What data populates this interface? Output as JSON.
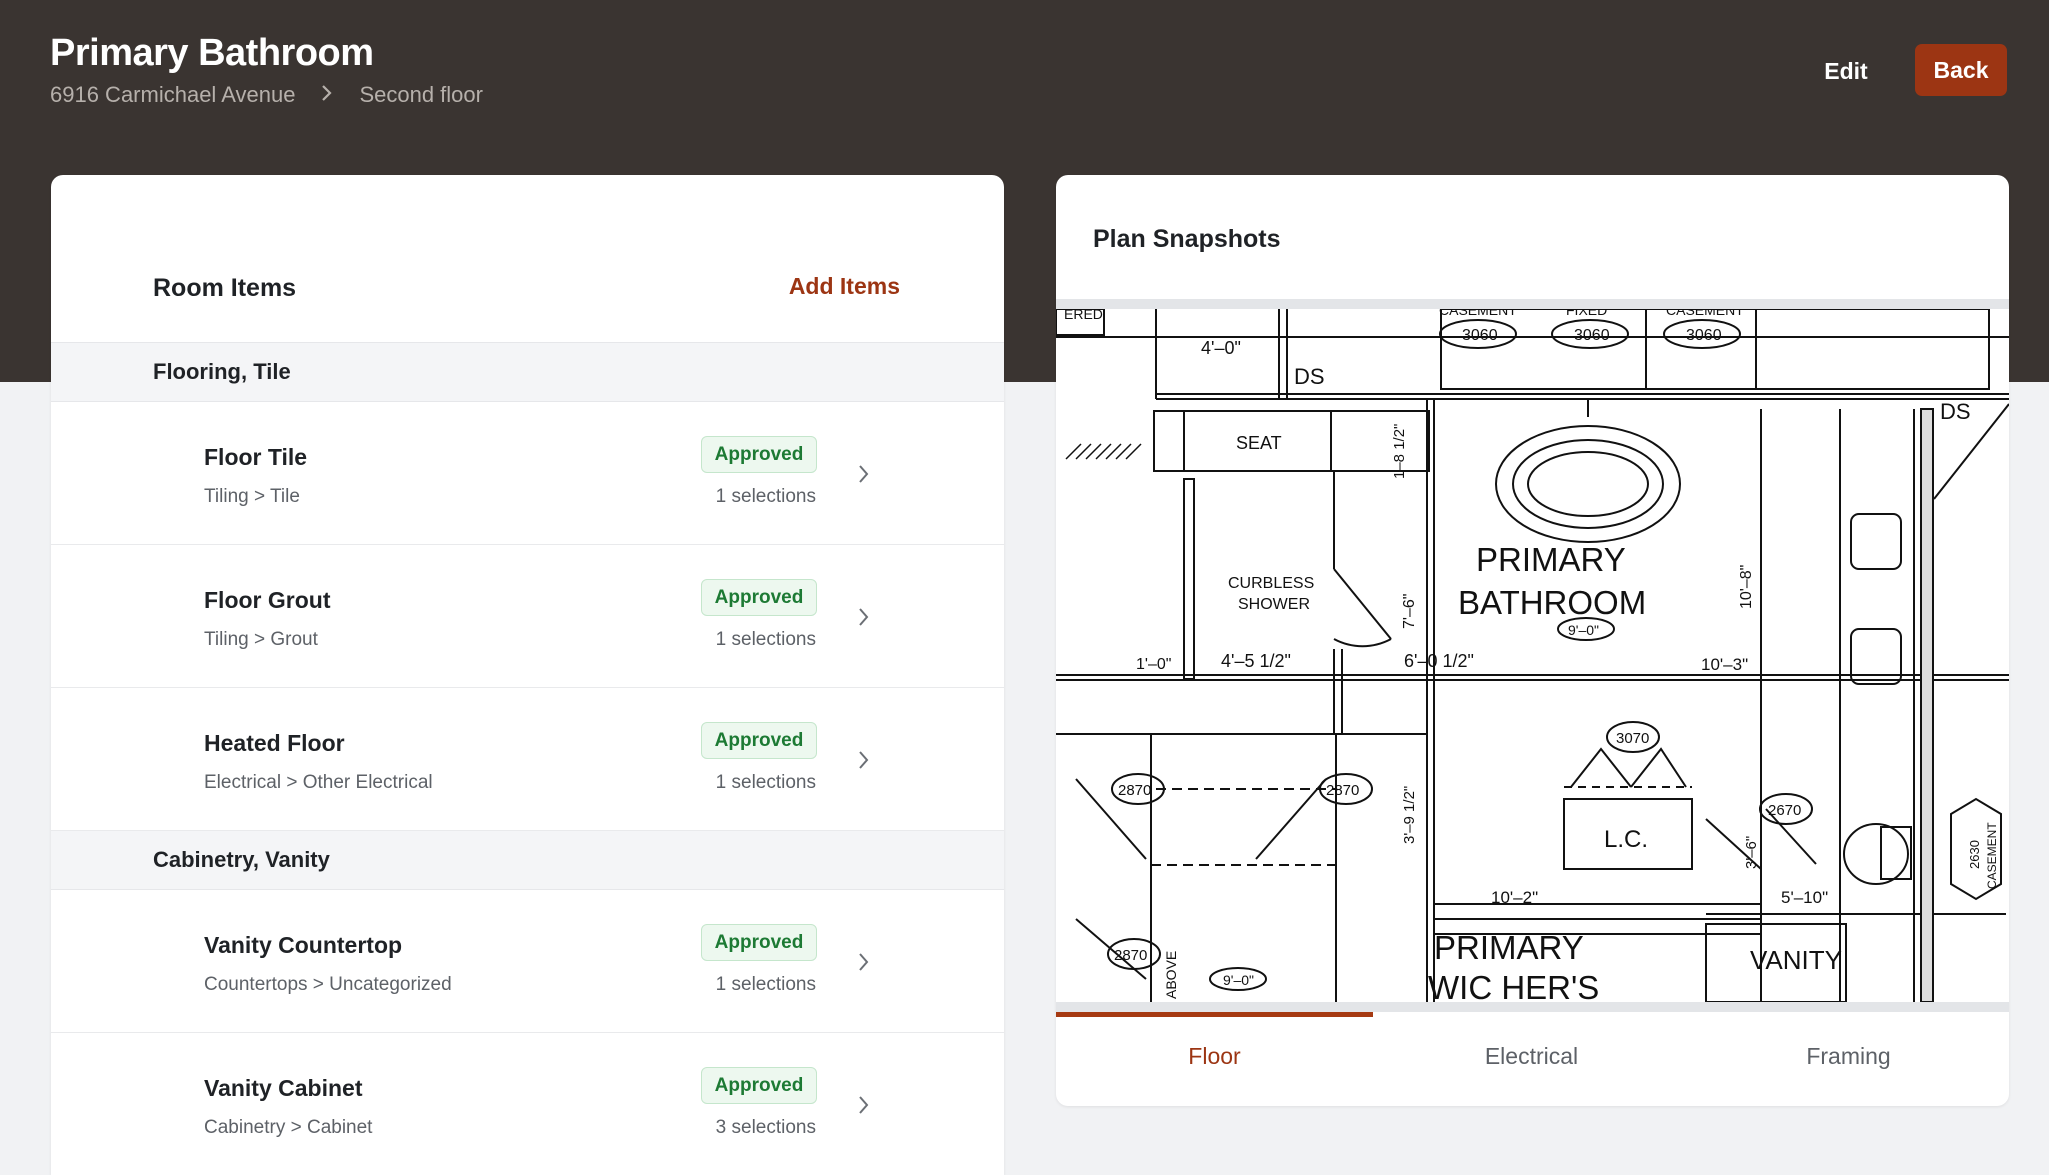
{
  "header": {
    "title": "Primary Bathroom",
    "breadcrumb": [
      "6916 Carmichael Avenue",
      "Second floor"
    ],
    "edit_label": "Edit",
    "back_label": "Back"
  },
  "room_items": {
    "title": "Room Items",
    "add_label": "Add Items",
    "groups": [
      {
        "name": "Flooring, Tile",
        "items": [
          {
            "name": "Floor Tile",
            "category": "Tiling > Tile",
            "status": "Approved",
            "selections": "1 selections"
          },
          {
            "name": "Floor Grout",
            "category": "Tiling > Grout",
            "status": "Approved",
            "selections": "1 selections"
          },
          {
            "name": "Heated Floor",
            "category": "Electrical > Other Electrical",
            "status": "Approved",
            "selections": "1 selections"
          }
        ]
      },
      {
        "name": "Cabinetry, Vanity",
        "items": [
          {
            "name": "Vanity Countertop",
            "category": "Countertops > Uncategorized",
            "status": "Approved",
            "selections": "1 selections"
          },
          {
            "name": "Vanity Cabinet",
            "category": "Cabinetry > Cabinet",
            "status": "Approved",
            "selections": "3 selections"
          }
        ]
      }
    ]
  },
  "plans": {
    "title": "Plan Snapshots",
    "tabs": [
      {
        "label": "Floor",
        "active": true
      },
      {
        "label": "Electrical",
        "active": false
      },
      {
        "label": "Framing",
        "active": false
      }
    ],
    "drawing_labels": {
      "casement_a": "CASEMENT",
      "window_a": "3060",
      "fixed": "FIXED",
      "window_b": "3060",
      "casement_b": "CASEMENT",
      "window_c": "3060",
      "dim_4_0": "4'–0\"",
      "ds_a": "DS",
      "ds_b": "DS",
      "seat": "SEAT",
      "dim_1_8_half": "1–8 1/2\"",
      "room_line1": "PRIMARY",
      "room_line2": "BATHROOM",
      "room_dim": "9'–0\"",
      "shower_line1": "CURBLESS",
      "shower_line2": "SHOWER",
      "dim_7_6": "7'–6\"",
      "dim_10_8": "10'–8\"",
      "dim_1_0": "1'–0\"",
      "dim_4_5_half": "4'–5 1/2\"",
      "dim_6_0_half": "6'–0 1/2\"",
      "dim_10_3": "10'–3\"",
      "door_3070": "3070",
      "door_2870_a": "2870",
      "door_2870_b": "2870",
      "door_2870_c": "2870",
      "dim_3_9_half": "3'–9 1/2\"",
      "lc": "L.C.",
      "door_2670": "2670",
      "dim_3_6": "3'–6\"",
      "window_2630": "2630",
      "casement_c": "CASEMENT",
      "dim_10_2": "10'–2\"",
      "dim_5_10": "5'–10\"",
      "wic_line1": "PRIMARY",
      "wic_line2": "WIC HER'S",
      "vanity": "VANITY",
      "above": "ABOVE",
      "wic_dim": "9'–0\"",
      "fixed_top": "ERED"
    }
  }
}
